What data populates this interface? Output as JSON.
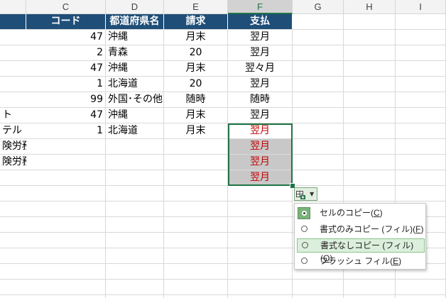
{
  "columns": [
    "C",
    "D",
    "E",
    "F",
    "G",
    "H",
    "I"
  ],
  "headers": {
    "C": "コード",
    "D": "都道府県名",
    "E": "請求",
    "F": "支払"
  },
  "rows": [
    {
      "b": "",
      "c": "47",
      "d": "沖縄",
      "e": "月末",
      "f": "翌月"
    },
    {
      "b": "",
      "c": "2",
      "d": "青森",
      "e": "20",
      "f": "翌月"
    },
    {
      "b": "",
      "c": "47",
      "d": "沖縄",
      "e": "月末",
      "f": "翌々月"
    },
    {
      "b": "",
      "c": "1",
      "d": "北海道",
      "e": "20",
      "f": "翌月"
    },
    {
      "b": "",
      "c": "99",
      "d": "外国･その他",
      "e": "随時",
      "f": "随時"
    },
    {
      "b": "ト",
      "c": "47",
      "d": "沖縄",
      "e": "月末",
      "f": "翌月"
    },
    {
      "b": "テル",
      "c": "1",
      "d": "北海道",
      "e": "月末",
      "f": "翌月"
    },
    {
      "b": "険労務士事務所",
      "c": "",
      "d": "",
      "e": "",
      "f": "翌月"
    },
    {
      "b": "険労務士事務所",
      "c": "",
      "d": "",
      "e": "",
      "f": "翌月"
    },
    {
      "b": "",
      "c": "",
      "d": "",
      "e": "",
      "f": "翌月"
    }
  ],
  "colors": {
    "header_bg": "#1f4e78",
    "accent": "#217346",
    "red_text": "#c00000"
  },
  "autofill_menu": {
    "items": [
      {
        "label": "セルのコピー(",
        "key": "C",
        "tail": ")",
        "selected": true
      },
      {
        "label": "書式のみコピー (フィル)(",
        "key": "F",
        "tail": ")",
        "selected": false
      },
      {
        "label": "書式なしコピー (フィル)(",
        "key": "O",
        "tail": ")",
        "selected": false,
        "hover": true
      },
      {
        "label": "フラッシュ フィル(",
        "key": "E",
        "tail": ")",
        "selected": false
      }
    ]
  }
}
